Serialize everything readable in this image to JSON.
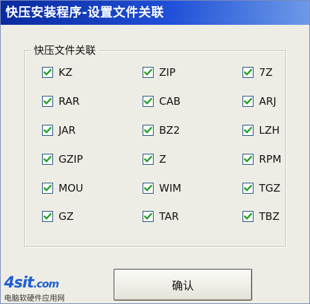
{
  "window": {
    "title": "快压安装程序-设置文件关联"
  },
  "group": {
    "label": "快压文件关联"
  },
  "items": [
    {
      "label": "KZ",
      "checked": true
    },
    {
      "label": "ZIP",
      "checked": true
    },
    {
      "label": "7Z",
      "checked": true
    },
    {
      "label": "RAR",
      "checked": true
    },
    {
      "label": "CAB",
      "checked": true
    },
    {
      "label": "ARJ",
      "checked": true
    },
    {
      "label": "JAR",
      "checked": true
    },
    {
      "label": "BZ2",
      "checked": true
    },
    {
      "label": "LZH",
      "checked": true
    },
    {
      "label": "GZIP",
      "checked": true
    },
    {
      "label": "Z",
      "checked": true
    },
    {
      "label": "RPM",
      "checked": true
    },
    {
      "label": "MOU",
      "checked": true
    },
    {
      "label": "WIM",
      "checked": true
    },
    {
      "label": "TGZ",
      "checked": true
    },
    {
      "label": "GZ",
      "checked": true
    },
    {
      "label": "TAR",
      "checked": true
    },
    {
      "label": "TBZ",
      "checked": true
    }
  ],
  "buttons": {
    "confirm_label": "确认"
  },
  "watermark": {
    "logo": "4sit",
    "logo_suffix": ".com",
    "subtitle": "电脑软硬件应用网"
  },
  "colors": {
    "title_bar_start": "#0a2a9e",
    "title_bar_end": "#6d9ae8",
    "window_background": "#eeede5",
    "checkmark": "#21a121"
  }
}
